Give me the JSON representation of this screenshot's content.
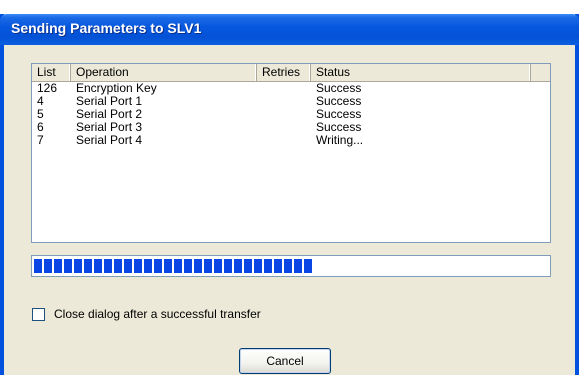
{
  "dialog": {
    "title": "Sending Parameters to SLV1"
  },
  "table": {
    "columns": [
      {
        "label": "List"
      },
      {
        "label": "Operation"
      },
      {
        "label": "Retries"
      },
      {
        "label": "Status"
      }
    ],
    "rows": [
      {
        "list": "126",
        "operation": "Encryption Key",
        "retries": "",
        "status": "Success"
      },
      {
        "list": "4",
        "operation": "Serial Port 1",
        "retries": "",
        "status": "Success"
      },
      {
        "list": "5",
        "operation": "Serial Port 2",
        "retries": "",
        "status": "Success"
      },
      {
        "list": "6",
        "operation": "Serial Port 3",
        "retries": "",
        "status": "Success"
      },
      {
        "list": "7",
        "operation": "Serial Port 4",
        "retries": "",
        "status": "Writing..."
      }
    ]
  },
  "progress": {
    "fraction": 0.54
  },
  "close_after_transfer": {
    "label": "Close dialog after a successful transfer",
    "checked": false
  },
  "buttons": {
    "cancel": "Cancel"
  },
  "colors": {
    "title_bar": "#0758de",
    "progress": "#0a46e4",
    "dialog_bg": "#ece9d8"
  }
}
